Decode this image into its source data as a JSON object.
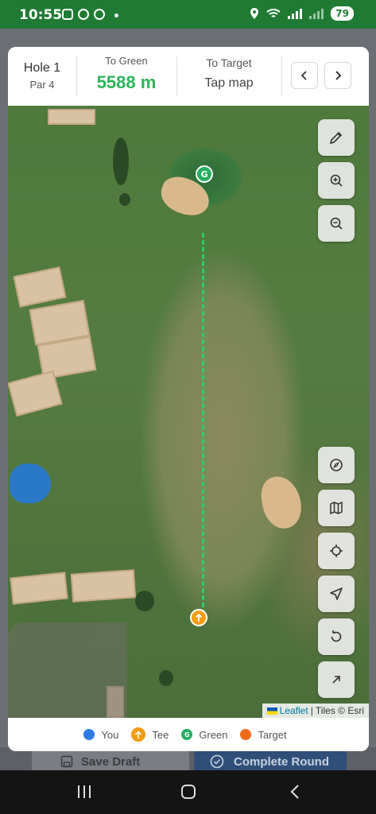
{
  "status_bar": {
    "time": "10:55",
    "battery": "79"
  },
  "hole": {
    "title": "Hole 1",
    "par": "Par 4"
  },
  "to_green": {
    "label": "To Green",
    "value": "5588 m"
  },
  "to_target": {
    "label": "To Target",
    "value": "Tap map"
  },
  "nav": {
    "prev_icon": "chevron-left-icon",
    "next_icon": "chevron-right-icon"
  },
  "markers": {
    "green": "G"
  },
  "map_controls": [
    "pencil-icon",
    "zoom-in-icon",
    "zoom-out-icon",
    "compass-icon",
    "map-icon",
    "locate-icon",
    "navigation-icon",
    "reset-icon",
    "arrow-up-right-icon"
  ],
  "attribution": {
    "leaflet": "Leaflet",
    "tiles": "| Tiles © Esri"
  },
  "legend": [
    {
      "label": "You",
      "color": "#2d7be5"
    },
    {
      "label": "Tee",
      "color": "#f39c12"
    },
    {
      "label": "Green",
      "color": "#27ae60",
      "glyph": "G"
    },
    {
      "label": "Target",
      "color": "#f26b1d"
    }
  ],
  "background_actions": {
    "save_draft": "Save Draft",
    "complete_round": "Complete Round"
  },
  "colors": {
    "accent_green": "#2bb55a",
    "status_bar": "#1f7a33"
  }
}
